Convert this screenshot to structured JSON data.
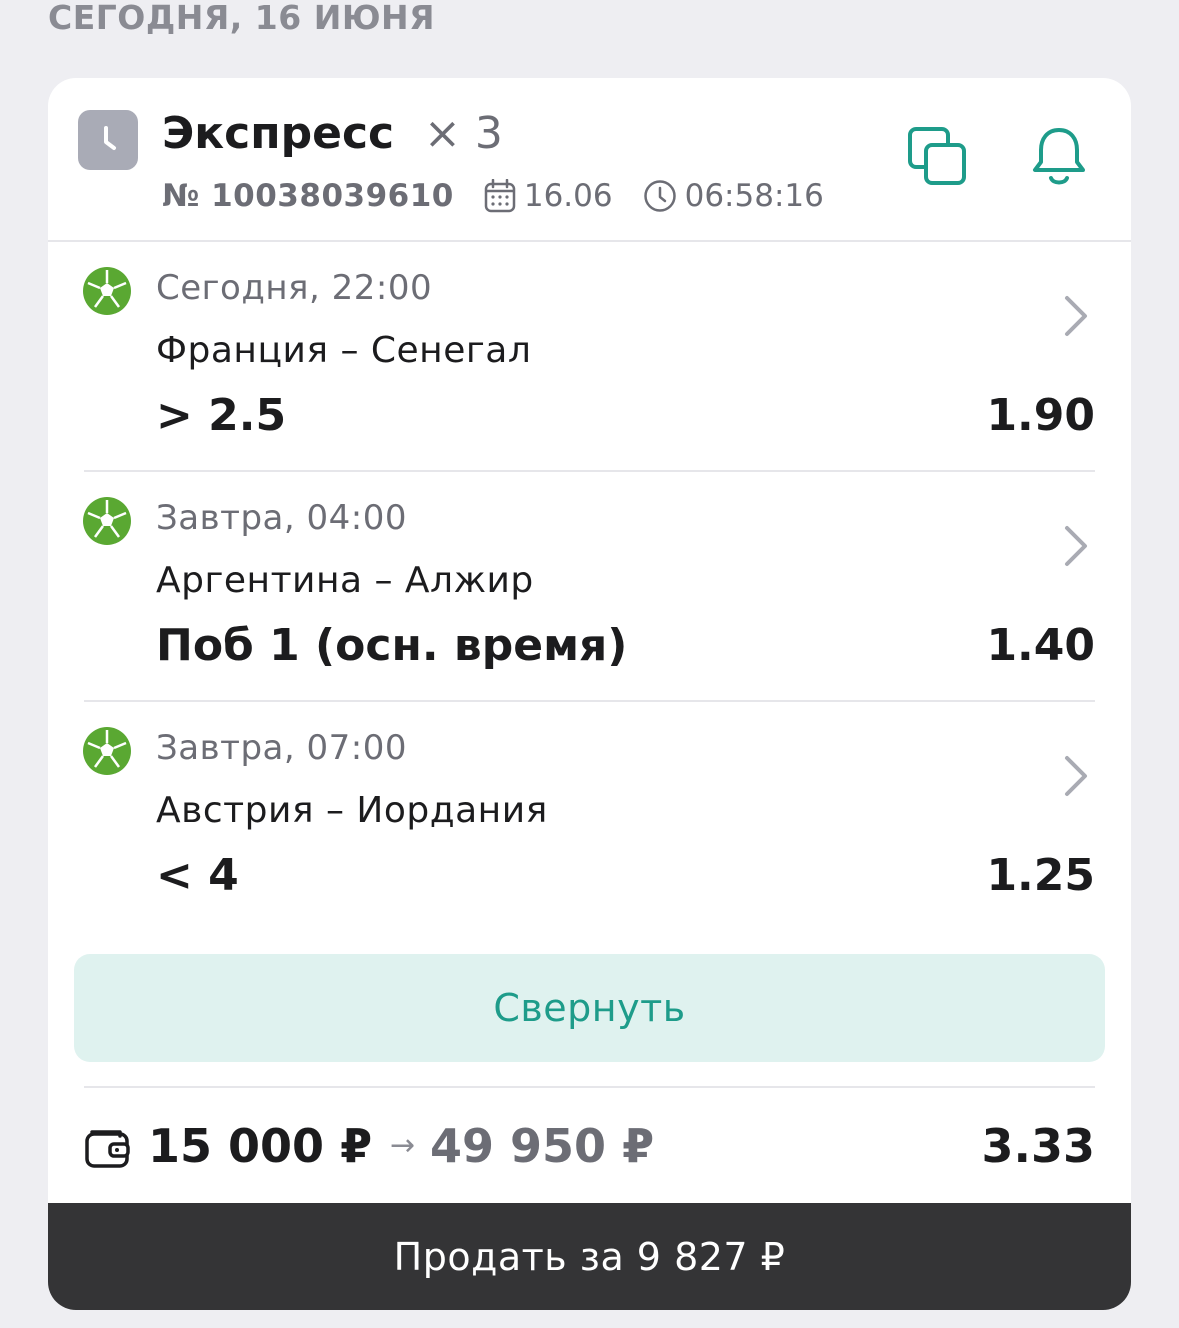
{
  "date_header": "СЕГОДНЯ, 16 ИЮНЯ",
  "header": {
    "bet_type": "Экспресс",
    "multiplier": "× 3",
    "bet_number": "№ 10038039610",
    "date": "16.06",
    "time": "06:58:16",
    "icons": {
      "status": "clock-icon",
      "copy": "copy-icon",
      "notify": "bell-icon"
    }
  },
  "selections": [
    {
      "when": "Сегодня, 22:00",
      "match": "Франция – Сенегал",
      "outcome": "> 2.5",
      "odds": "1.90",
      "sport_icon": "football-icon"
    },
    {
      "when": "Завтра, 04:00",
      "match": "Аргентина – Алжир",
      "outcome": "Поб 1 (осн. время)",
      "odds": "1.40",
      "sport_icon": "football-icon"
    },
    {
      "when": "Завтра, 07:00",
      "match": "Австрия – Иордания",
      "outcome": "< 4",
      "odds": "1.25",
      "sport_icon": "football-icon"
    }
  ],
  "collapse_label": "Свернуть",
  "footer": {
    "stake": "15 000 ₽",
    "arrow": "→",
    "payout": "49 950 ₽",
    "total_odds": "3.33"
  },
  "sell_label": "Продать за 9 827 ₽",
  "colors": {
    "accent_green": "#1e9c8a",
    "collapse_bg": "#dff2ef",
    "ball_green": "#5aa832",
    "sell_bg": "#343436"
  }
}
